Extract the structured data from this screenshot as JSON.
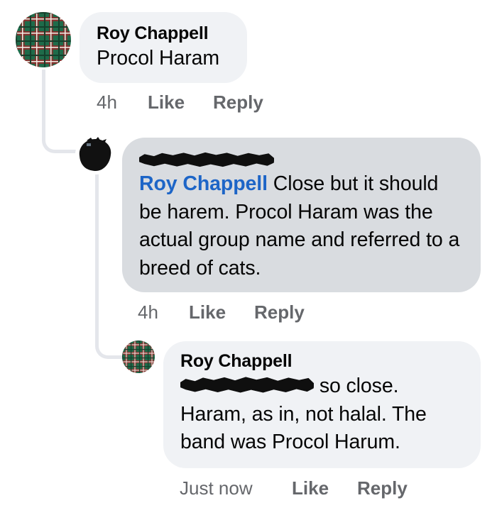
{
  "comments": [
    {
      "author": "Roy Chappell",
      "text": "Procol Haram",
      "time": "4h",
      "like_label": "Like",
      "reply_label": "Reply"
    },
    {
      "author_redacted": true,
      "mention": "Roy Chappell",
      "text": " Close but it should be harem. Procol Haram was the actual group name and referred to a breed of cats.",
      "time": "4h",
      "like_label": "Like",
      "reply_label": "Reply"
    },
    {
      "author": "Roy Chappell",
      "mention_redacted": true,
      "text": " so close. Haram, as in, not halal. The band was Procol Harum.",
      "time": "Just now",
      "like_label": "Like",
      "reply_label": "Reply"
    }
  ],
  "colors": {
    "bubble_light": "#f0f2f5",
    "bubble_gray": "#d9dce0",
    "mention_blue": "#1d65c7",
    "meta_gray": "#65676b",
    "thread_line": "#e4e6eb",
    "plaid_green": "#1f6b4a",
    "plaid_red": "#8f2b2b"
  },
  "icons": {
    "avatar_roy": "plaid-avatar-icon",
    "avatar_reply": "redacted-avatar-icon"
  }
}
